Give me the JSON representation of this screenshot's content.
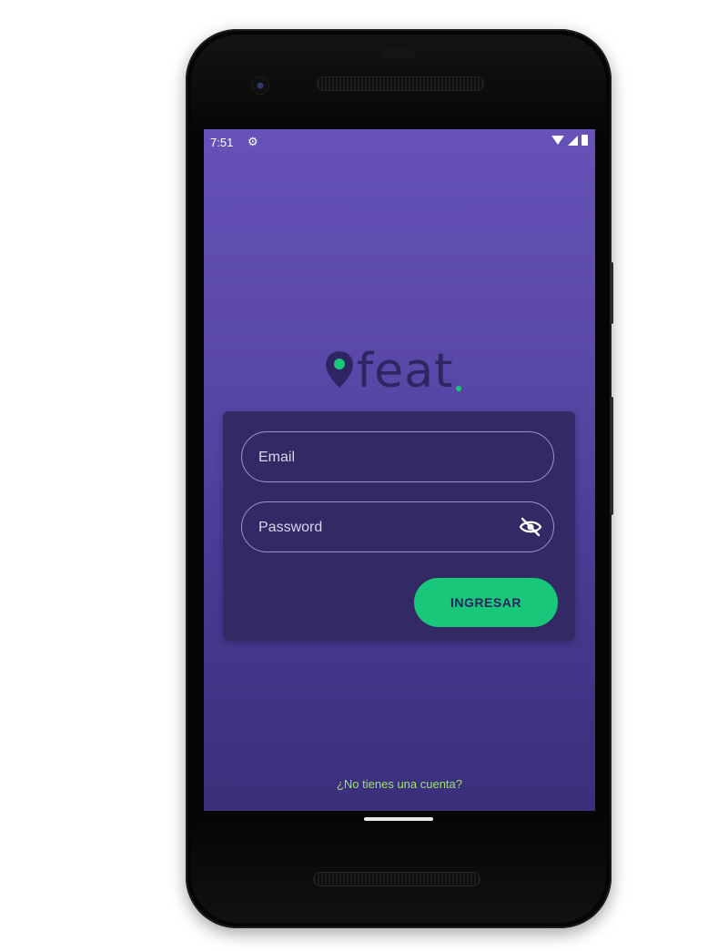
{
  "status_bar": {
    "time": "7:51",
    "left_icons": [
      "settings-icon"
    ],
    "right_icons": [
      "wifi-icon",
      "signal-icon",
      "battery-icon"
    ]
  },
  "brand": {
    "name": "feat",
    "accent": "#19c77a",
    "primary": "#2f2563",
    "background_top": "#6652b8",
    "background_bottom": "#3b2e7a"
  },
  "form": {
    "email": {
      "placeholder": "Email",
      "value": ""
    },
    "password": {
      "placeholder": "Password",
      "value": "",
      "toggle_icon": "eye-off-icon"
    },
    "submit_label": "INGRESAR"
  },
  "signup_link": "¿No tienes una cuenta?"
}
